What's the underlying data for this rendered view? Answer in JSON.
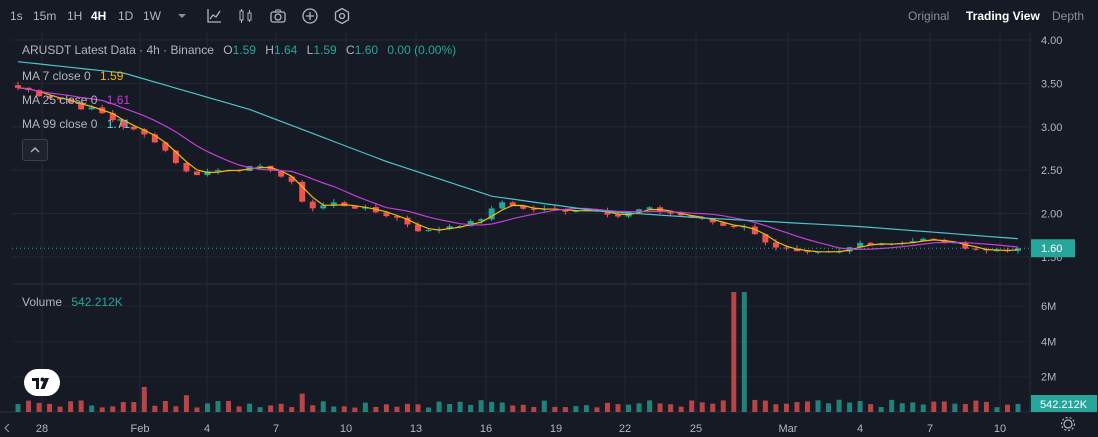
{
  "toolbar": {
    "timeframes": [
      "1s",
      "15m",
      "1H",
      "4H",
      "1D",
      "1W"
    ],
    "active_timeframe": "4H",
    "views": [
      "Original",
      "Trading View",
      "Depth"
    ],
    "active_view": "Trading View"
  },
  "legend": {
    "symbol": "ARUSDT Latest Data · 4h · Binance",
    "o_label": "O",
    "o_value": "1.59",
    "h_label": "H",
    "h_value": "1.64",
    "l_label": "L",
    "l_value": "1.59",
    "c_label": "C",
    "c_value": "1.60",
    "change": "0.00 (0.00%)",
    "ma7_label": "MA 7 close 0",
    "ma7_value": "1.59",
    "ma25_label": "MA 25 close 0",
    "ma25_value": "1.61",
    "ma99_label": "MA 99 close 0",
    "ma99_value": "1.71",
    "volume_label": "Volume",
    "volume_value": "542.212K"
  },
  "colors": {
    "up": "#26a69a",
    "down": "#ef5350",
    "ma7": "#f0b90b",
    "ma25": "#c43ed8",
    "ma99": "#4fc3c7",
    "background": "#161a25",
    "grid": "#242833"
  },
  "chart_data": {
    "type": "candlestick",
    "title": "ARUSDT Latest Data · 4h · Binance",
    "price_axis": {
      "ticks": [
        "4.00",
        "3.50",
        "3.00",
        "2.50",
        "2.00",
        "1.50"
      ],
      "ylim": [
        1.43,
        4.0
      ]
    },
    "last_price": "1.60",
    "volume_axis": {
      "ticks": [
        "6M",
        "4M",
        "2M"
      ]
    },
    "last_volume": "542.212K",
    "x_ticks": [
      "28",
      "Feb",
      "4",
      "7",
      "10",
      "13",
      "16",
      "19",
      "22",
      "25",
      "Mar",
      "4",
      "7",
      "10"
    ],
    "close_keypoints": [
      {
        "t": 0,
        "v": 3.45
      },
      {
        "t": 4,
        "v": 3.32
      },
      {
        "t": 8,
        "v": 3.15
      },
      {
        "t": 11,
        "v": 2.95
      },
      {
        "t": 13,
        "v": 2.85
      },
      {
        "t": 15,
        "v": 2.6
      },
      {
        "t": 16.2,
        "v": 2.45
      },
      {
        "t": 20,
        "v": 2.52
      },
      {
        "t": 24,
        "v": 2.52
      },
      {
        "t": 26.2,
        "v": 2.32
      },
      {
        "t": 27.5,
        "v": 2.05
      },
      {
        "t": 30,
        "v": 2.12
      },
      {
        "t": 33,
        "v": 2.05
      },
      {
        "t": 36,
        "v": 1.95
      },
      {
        "t": 38.5,
        "v": 1.78
      },
      {
        "t": 41,
        "v": 1.86
      },
      {
        "t": 43.5,
        "v": 1.9
      },
      {
        "t": 46.2,
        "v": 2.15
      },
      {
        "t": 48,
        "v": 2.05
      },
      {
        "t": 52,
        "v": 2.04
      },
      {
        "t": 55,
        "v": 2.05
      },
      {
        "t": 57,
        "v": 1.97
      },
      {
        "t": 59.5,
        "v": 2.06
      },
      {
        "t": 63,
        "v": 1.98
      },
      {
        "t": 66,
        "v": 1.9
      },
      {
        "t": 67.8,
        "v": 1.83
      },
      {
        "t": 68.5,
        "v": 1.92
      },
      {
        "t": 70,
        "v": 1.75
      },
      {
        "t": 72,
        "v": 1.62
      },
      {
        "t": 74.5,
        "v": 1.53
      },
      {
        "t": 78,
        "v": 1.55
      },
      {
        "t": 80,
        "v": 1.66
      },
      {
        "t": 83,
        "v": 1.66
      },
      {
        "t": 86,
        "v": 1.7
      },
      {
        "t": 88,
        "v": 1.67
      },
      {
        "t": 90,
        "v": 1.62
      },
      {
        "t": 92,
        "v": 1.57
      },
      {
        "t": 95,
        "v": 1.6
      }
    ],
    "volume_spike": {
      "t": 68.5,
      "value_m": 6.8
    },
    "ma99_keypoints": [
      {
        "t": 0,
        "v": 3.75
      },
      {
        "t": 10,
        "v": 3.62
      },
      {
        "t": 22,
        "v": 3.2
      },
      {
        "t": 35,
        "v": 2.6
      },
      {
        "t": 45,
        "v": 2.2
      },
      {
        "t": 55,
        "v": 2.03
      },
      {
        "t": 65,
        "v": 1.95
      },
      {
        "t": 80,
        "v": 1.85
      },
      {
        "t": 95,
        "v": 1.71
      }
    ]
  }
}
